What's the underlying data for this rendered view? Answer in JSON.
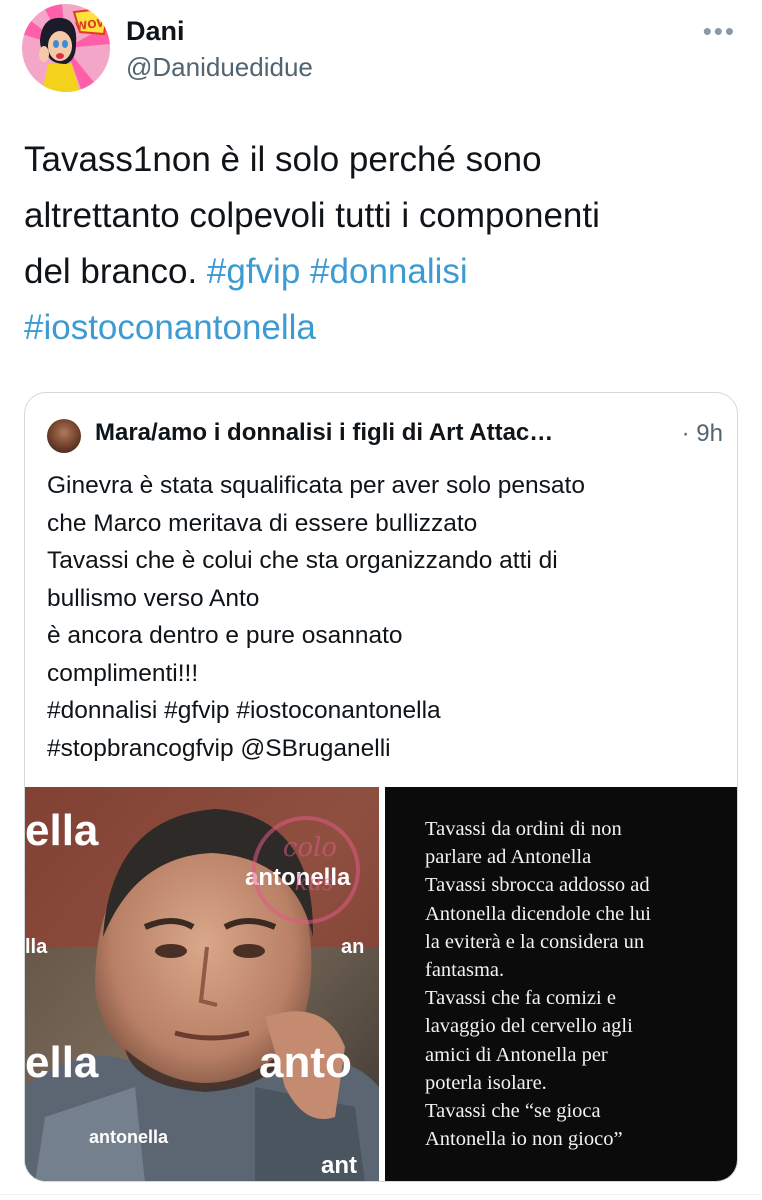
{
  "tweet": {
    "author_name": "Dani",
    "author_handle": "@Daniduedidue",
    "more_label": "•••",
    "text_lines": [
      {
        "plain": "Tavass1non è il solo perché sono",
        "tag1": "",
        "tag2": ""
      },
      {
        "plain": "altrettanto colpevoli tutti i componenti",
        "tag1": "",
        "tag2": ""
      },
      {
        "plain": "del branco. ",
        "tag1": "#gfvip",
        "tag2": "#donnalisi"
      },
      {
        "plain": "",
        "tag1": "#iostoconantonella",
        "tag2": ""
      }
    ],
    "colors": {
      "hashtag": "#3d9bd3",
      "text": "#0f1419",
      "secondary": "#536471",
      "border": "#cfd9de"
    }
  },
  "quote": {
    "author_name": "Mara/amo i donnalisi i figli di Art Attac…",
    "time": "· 9h",
    "lines": [
      "Ginevra è stata squalificata per aver solo pensato",
      "che Marco meritava di essere bullizzato",
      "Tavassi che è colui che sta organizzando atti di",
      "bullismo verso Anto",
      "è ancora dentro e pure osannato",
      "complimenti!!!",
      "#donnalisi #gfvip #iostoconantonella",
      "#stopbrancogfvip @SBruganelli"
    ]
  },
  "media": {
    "photo_overlay_words": [
      "ella",
      "antonella",
      "lla",
      "an",
      "ella",
      "anto",
      "antonella",
      "ant"
    ],
    "story_lines": [
      "Tavassi da ordini di non",
      "parlare ad Antonella",
      "Tavassi sbrocca addosso ad",
      "Antonella dicendole che lui",
      "la eviterà e la considera un",
      "fantasma.",
      "Tavassi che fa comizi e",
      "lavaggio del cervello agli",
      "amici di Antonella per",
      "poterla isolare.",
      "Tavassi che “se gioca",
      "Antonella io non gioco”"
    ],
    "watermark_text": [
      "colo",
      "kus"
    ],
    "avatar_badge": "WOW"
  }
}
